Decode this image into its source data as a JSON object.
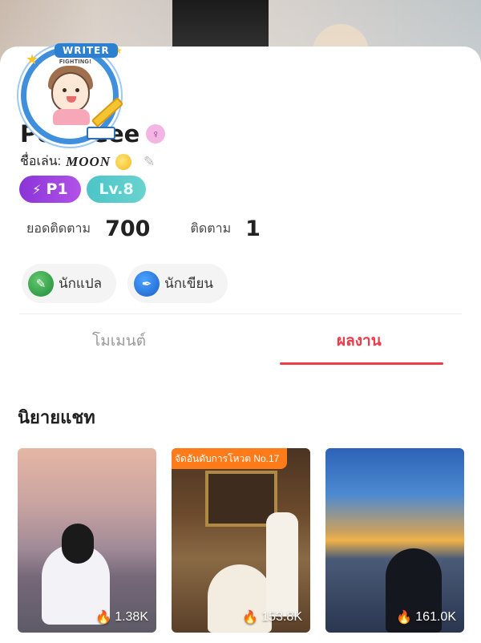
{
  "avatar": {
    "badge_text": "WRITER",
    "badge_subtext": "FIGHTING!"
  },
  "profile": {
    "name": "Pookieee",
    "gender_icon": "female-symbol-icon",
    "nickname_label": "ชื่อเล่น:",
    "nickname_value": "MOON",
    "tags": {
      "rank": "P1",
      "level": "Lv.8"
    },
    "followers_label": "ยอดติดตาม",
    "followers_count": "700",
    "following_label": "ติดตาม",
    "following_count": "1",
    "roles": [
      "นักแปล",
      "นักเขียน"
    ]
  },
  "tabs": {
    "moment": "โมเมนต์",
    "works": "ผลงาน"
  },
  "section": {
    "title": "นิยายแชท"
  },
  "works": [
    {
      "views": "1.38K",
      "rank_label": ""
    },
    {
      "views": "153.8K",
      "rank_label": "จัดอันดับการโหวต No.17"
    },
    {
      "views": "161.0K",
      "rank_label": ""
    }
  ],
  "colors": {
    "accent_red": "#ef3a4a",
    "rank_purple": "#8a34d8",
    "level_teal": "#4cc4c8",
    "rank_orange": "#ff7b1a"
  }
}
